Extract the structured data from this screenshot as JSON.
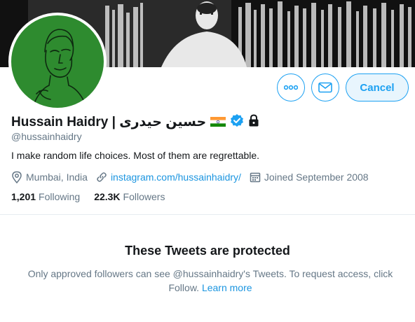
{
  "profile": {
    "display_name": "Hussain Haidry | حسین حیدری",
    "handle": "@hussainhaidry",
    "bio": "I make random life choices. Most of them are regrettable.",
    "location": "Mumbai, India",
    "website": "instagram.com/hussainhaidry/",
    "joined": "Joined September 2008",
    "following_count": "1,201",
    "following_label": "Following",
    "followers_count": "22.3K",
    "followers_label": "Followers",
    "badges": [
      "india-flag-icon",
      "verified-badge-icon",
      "lock-icon"
    ]
  },
  "actions": {
    "cancel_label": "Cancel",
    "more_icon": "more-icon",
    "message_icon": "envelope-icon"
  },
  "protected": {
    "title": "These Tweets are protected",
    "body": "Only approved followers can see @hussainhaidry's Tweets. To request access, click Follow.",
    "learn_more": "Learn more"
  },
  "colors": {
    "accent": "#1da1f2",
    "link": "#1b95e0",
    "muted": "#657786",
    "avatar_bg": "#2e8b2f"
  }
}
